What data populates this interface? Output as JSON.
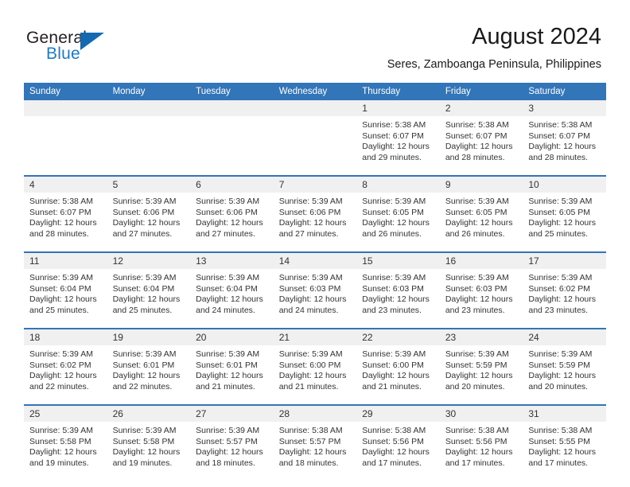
{
  "brand": {
    "line1": "General",
    "line2": "Blue",
    "flag_color": "#1469b0",
    "blue_text_color": "#1f7ac4"
  },
  "header": {
    "title": "August 2024",
    "subtitle": "Seres, Zamboanga Peninsula, Philippines",
    "accent_color": "#3275b8",
    "daynum_band_color": "#f0f0f0"
  },
  "weekdays": [
    "Sunday",
    "Monday",
    "Tuesday",
    "Wednesday",
    "Thursday",
    "Friday",
    "Saturday"
  ],
  "labels": {
    "sunrise_prefix": "Sunrise:",
    "sunset_prefix": "Sunset:",
    "daylight_prefix": "Daylight:"
  },
  "weeks": [
    [
      {
        "day": "",
        "empty": true
      },
      {
        "day": "",
        "empty": true
      },
      {
        "day": "",
        "empty": true
      },
      {
        "day": "",
        "empty": true
      },
      {
        "day": "1",
        "sunrise": "Sunrise: 5:38 AM",
        "sunset": "Sunset: 6:07 PM",
        "daylight1": "Daylight: 12 hours",
        "daylight2": "and 29 minutes."
      },
      {
        "day": "2",
        "sunrise": "Sunrise: 5:38 AM",
        "sunset": "Sunset: 6:07 PM",
        "daylight1": "Daylight: 12 hours",
        "daylight2": "and 28 minutes."
      },
      {
        "day": "3",
        "sunrise": "Sunrise: 5:38 AM",
        "sunset": "Sunset: 6:07 PM",
        "daylight1": "Daylight: 12 hours",
        "daylight2": "and 28 minutes."
      }
    ],
    [
      {
        "day": "4",
        "sunrise": "Sunrise: 5:38 AM",
        "sunset": "Sunset: 6:07 PM",
        "daylight1": "Daylight: 12 hours",
        "daylight2": "and 28 minutes."
      },
      {
        "day": "5",
        "sunrise": "Sunrise: 5:39 AM",
        "sunset": "Sunset: 6:06 PM",
        "daylight1": "Daylight: 12 hours",
        "daylight2": "and 27 minutes."
      },
      {
        "day": "6",
        "sunrise": "Sunrise: 5:39 AM",
        "sunset": "Sunset: 6:06 PM",
        "daylight1": "Daylight: 12 hours",
        "daylight2": "and 27 minutes."
      },
      {
        "day": "7",
        "sunrise": "Sunrise: 5:39 AM",
        "sunset": "Sunset: 6:06 PM",
        "daylight1": "Daylight: 12 hours",
        "daylight2": "and 27 minutes."
      },
      {
        "day": "8",
        "sunrise": "Sunrise: 5:39 AM",
        "sunset": "Sunset: 6:05 PM",
        "daylight1": "Daylight: 12 hours",
        "daylight2": "and 26 minutes."
      },
      {
        "day": "9",
        "sunrise": "Sunrise: 5:39 AM",
        "sunset": "Sunset: 6:05 PM",
        "daylight1": "Daylight: 12 hours",
        "daylight2": "and 26 minutes."
      },
      {
        "day": "10",
        "sunrise": "Sunrise: 5:39 AM",
        "sunset": "Sunset: 6:05 PM",
        "daylight1": "Daylight: 12 hours",
        "daylight2": "and 25 minutes."
      }
    ],
    [
      {
        "day": "11",
        "sunrise": "Sunrise: 5:39 AM",
        "sunset": "Sunset: 6:04 PM",
        "daylight1": "Daylight: 12 hours",
        "daylight2": "and 25 minutes."
      },
      {
        "day": "12",
        "sunrise": "Sunrise: 5:39 AM",
        "sunset": "Sunset: 6:04 PM",
        "daylight1": "Daylight: 12 hours",
        "daylight2": "and 25 minutes."
      },
      {
        "day": "13",
        "sunrise": "Sunrise: 5:39 AM",
        "sunset": "Sunset: 6:04 PM",
        "daylight1": "Daylight: 12 hours",
        "daylight2": "and 24 minutes."
      },
      {
        "day": "14",
        "sunrise": "Sunrise: 5:39 AM",
        "sunset": "Sunset: 6:03 PM",
        "daylight1": "Daylight: 12 hours",
        "daylight2": "and 24 minutes."
      },
      {
        "day": "15",
        "sunrise": "Sunrise: 5:39 AM",
        "sunset": "Sunset: 6:03 PM",
        "daylight1": "Daylight: 12 hours",
        "daylight2": "and 23 minutes."
      },
      {
        "day": "16",
        "sunrise": "Sunrise: 5:39 AM",
        "sunset": "Sunset: 6:03 PM",
        "daylight1": "Daylight: 12 hours",
        "daylight2": "and 23 minutes."
      },
      {
        "day": "17",
        "sunrise": "Sunrise: 5:39 AM",
        "sunset": "Sunset: 6:02 PM",
        "daylight1": "Daylight: 12 hours",
        "daylight2": "and 23 minutes."
      }
    ],
    [
      {
        "day": "18",
        "sunrise": "Sunrise: 5:39 AM",
        "sunset": "Sunset: 6:02 PM",
        "daylight1": "Daylight: 12 hours",
        "daylight2": "and 22 minutes."
      },
      {
        "day": "19",
        "sunrise": "Sunrise: 5:39 AM",
        "sunset": "Sunset: 6:01 PM",
        "daylight1": "Daylight: 12 hours",
        "daylight2": "and 22 minutes."
      },
      {
        "day": "20",
        "sunrise": "Sunrise: 5:39 AM",
        "sunset": "Sunset: 6:01 PM",
        "daylight1": "Daylight: 12 hours",
        "daylight2": "and 21 minutes."
      },
      {
        "day": "21",
        "sunrise": "Sunrise: 5:39 AM",
        "sunset": "Sunset: 6:00 PM",
        "daylight1": "Daylight: 12 hours",
        "daylight2": "and 21 minutes."
      },
      {
        "day": "22",
        "sunrise": "Sunrise: 5:39 AM",
        "sunset": "Sunset: 6:00 PM",
        "daylight1": "Daylight: 12 hours",
        "daylight2": "and 21 minutes."
      },
      {
        "day": "23",
        "sunrise": "Sunrise: 5:39 AM",
        "sunset": "Sunset: 5:59 PM",
        "daylight1": "Daylight: 12 hours",
        "daylight2": "and 20 minutes."
      },
      {
        "day": "24",
        "sunrise": "Sunrise: 5:39 AM",
        "sunset": "Sunset: 5:59 PM",
        "daylight1": "Daylight: 12 hours",
        "daylight2": "and 20 minutes."
      }
    ],
    [
      {
        "day": "25",
        "sunrise": "Sunrise: 5:39 AM",
        "sunset": "Sunset: 5:58 PM",
        "daylight1": "Daylight: 12 hours",
        "daylight2": "and 19 minutes."
      },
      {
        "day": "26",
        "sunrise": "Sunrise: 5:39 AM",
        "sunset": "Sunset: 5:58 PM",
        "daylight1": "Daylight: 12 hours",
        "daylight2": "and 19 minutes."
      },
      {
        "day": "27",
        "sunrise": "Sunrise: 5:39 AM",
        "sunset": "Sunset: 5:57 PM",
        "daylight1": "Daylight: 12 hours",
        "daylight2": "and 18 minutes."
      },
      {
        "day": "28",
        "sunrise": "Sunrise: 5:38 AM",
        "sunset": "Sunset: 5:57 PM",
        "daylight1": "Daylight: 12 hours",
        "daylight2": "and 18 minutes."
      },
      {
        "day": "29",
        "sunrise": "Sunrise: 5:38 AM",
        "sunset": "Sunset: 5:56 PM",
        "daylight1": "Daylight: 12 hours",
        "daylight2": "and 17 minutes."
      },
      {
        "day": "30",
        "sunrise": "Sunrise: 5:38 AM",
        "sunset": "Sunset: 5:56 PM",
        "daylight1": "Daylight: 12 hours",
        "daylight2": "and 17 minutes."
      },
      {
        "day": "31",
        "sunrise": "Sunrise: 5:38 AM",
        "sunset": "Sunset: 5:55 PM",
        "daylight1": "Daylight: 12 hours",
        "daylight2": "and 17 minutes."
      }
    ]
  ]
}
